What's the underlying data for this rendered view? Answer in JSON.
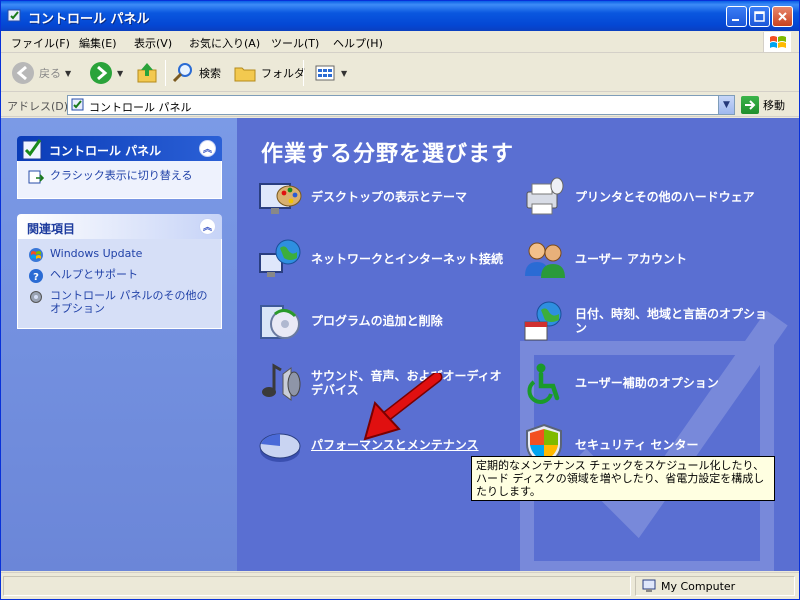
{
  "window": {
    "title": "コントロール パネル"
  },
  "menubar": {
    "items": [
      "ファイル(F)",
      "編集(E)",
      "表示(V)",
      "お気に入り(A)",
      "ツール(T)",
      "ヘルプ(H)"
    ]
  },
  "toolbar": {
    "back_label": "戻る",
    "search_label": "検索",
    "folders_label": "フォルダ"
  },
  "address": {
    "label": "アドレス(D)",
    "value": "コントロール パネル",
    "go_label": "移動"
  },
  "leftpane": {
    "control_panel_box": {
      "title": "コントロール パネル",
      "tasks": [
        "クラシック表示に切り替える"
      ]
    },
    "related_box": {
      "title": "関連項目",
      "tasks": [
        "Windows Update",
        "ヘルプとサポート",
        "コントロール パネルのその他のオプション"
      ]
    }
  },
  "main": {
    "title": "作業する分野を選びます",
    "categories": [
      "デスクトップの表示とテーマ",
      "プリンタとその他のハードウェア",
      "ネットワークとインターネット接続",
      "ユーザー アカウント",
      "プログラムの追加と削除",
      "日付、時刻、地域と言語のオプション",
      "サウンド、音声、およびオーディオ デバイス",
      "ユーザー補助のオプション",
      "パフォーマンスとメンテナンス",
      "セキュリティ センター"
    ],
    "tooltip": "定期的なメンテナンス チェックをスケジュール化したり、ハード ディスクの領域を増やしたり、省電力設定を構成したりします。"
  },
  "statusbar": {
    "zone": "My Computer"
  },
  "colors": {
    "titlebar_blue": "#0a57df",
    "content_blue": "#5a6fd2",
    "link_blue": "#2142a8",
    "tooltip_bg": "#ffffe1",
    "arrow_red": "#e01010"
  }
}
